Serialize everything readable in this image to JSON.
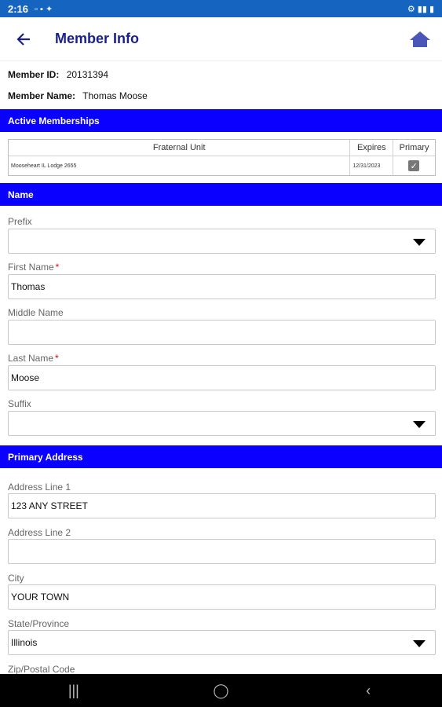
{
  "status": {
    "time": "2:16",
    "left_icons": "▫ ▪ ✦",
    "right_icons": "⚙ ▮▮ ▮"
  },
  "appbar": {
    "title": "Member Info"
  },
  "member": {
    "id_label": "Member ID:",
    "id_value": "20131394",
    "name_label": "Member Name:",
    "name_value": "Thomas Moose"
  },
  "sections": {
    "active": "Active Memberships",
    "name": "Name",
    "address": "Primary Address"
  },
  "memberships": {
    "headers": [
      "Fraternal Unit",
      "Expires",
      "Primary"
    ],
    "rows": [
      {
        "unit": "Mooseheart IL Lodge 2655",
        "expires": "12/31/2023",
        "primary": true
      }
    ]
  },
  "form": {
    "prefix_label": "Prefix",
    "prefix_value": "",
    "first_label": "First Name",
    "first_value": "Thomas",
    "middle_label": "Middle Name",
    "middle_value": "",
    "last_label": "Last Name",
    "last_value": "Moose",
    "suffix_label": "Suffix",
    "suffix_value": "",
    "required_mark": "*",
    "addr1_label": "Address Line 1",
    "addr1_value": "123 ANY STREET",
    "addr2_label": "Address Line 2",
    "addr2_value": "",
    "city_label": "City",
    "city_value": "YOUR TOWN",
    "state_label": "State/Province",
    "state_value": "Illinois",
    "zip_label": "Zip/Postal Code"
  },
  "navbar": {
    "recent": "|||",
    "home": "◯",
    "back": "‹"
  },
  "colors": {
    "section": "#0a00ff",
    "title": "#1a1f8c",
    "status": "#1565c0"
  }
}
